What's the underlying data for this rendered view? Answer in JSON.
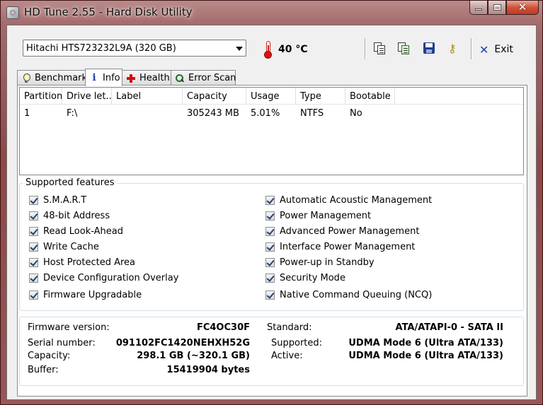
{
  "window": {
    "title": "HD Tune 2.55 - Hard Disk Utility"
  },
  "toolbar": {
    "drive": "Hitachi HTS723232L9A (320 GB)",
    "temperature": "40 °C",
    "exit_label": "Exit",
    "icons": [
      "copy-info-icon",
      "copy-icon",
      "save-icon",
      "options-icon"
    ]
  },
  "tabs": [
    {
      "label": "Benchmark",
      "icon": "lightbulb-icon"
    },
    {
      "label": "Info",
      "icon": "info-icon",
      "active": true
    },
    {
      "label": "Health",
      "icon": "health-cross-icon"
    },
    {
      "label": "Error Scan",
      "icon": "magnifier-icon"
    }
  ],
  "partitions": {
    "columns": [
      "Partition",
      "Drive let...",
      "Label",
      "Capacity",
      "Usage",
      "Type",
      "Bootable"
    ],
    "rows": [
      [
        "1",
        "F:\\",
        "",
        "305243 MB",
        "5.01%",
        "NTFS",
        "No"
      ]
    ]
  },
  "features": {
    "title": "Supported features",
    "left": [
      {
        "label": "S.M.A.R.T",
        "checked": true
      },
      {
        "label": "48-bit Address",
        "checked": true
      },
      {
        "label": "Read Look-Ahead",
        "checked": true
      },
      {
        "label": "Write Cache",
        "checked": true
      },
      {
        "label": "Host Protected Area",
        "checked": true
      },
      {
        "label": "Device Configuration Overlay",
        "checked": true
      },
      {
        "label": "Firmware Upgradable",
        "checked": true
      }
    ],
    "right": [
      {
        "label": "Automatic Acoustic Management",
        "checked": true
      },
      {
        "label": "Power Management",
        "checked": true
      },
      {
        "label": "Advanced Power Management",
        "checked": true
      },
      {
        "label": "Interface Power Management",
        "checked": true
      },
      {
        "label": "Power-up in Standby",
        "checked": true
      },
      {
        "label": "Security Mode",
        "checked": true
      },
      {
        "label": "Native Command Queuing (NCQ)",
        "checked": true
      }
    ]
  },
  "details": {
    "firmware_label": "Firmware version:",
    "firmware": "FC4OC30F",
    "serial_label": "Serial number:",
    "serial": "091102FC1420NEHXH52G",
    "capacity_label": "Capacity:",
    "capacity": "298.1 GB (~320.1 GB)",
    "buffer_label": "Buffer:",
    "buffer": "15419904 bytes",
    "standard_label": "Standard:",
    "standard": "ATA/ATAPI-0 - SATA II",
    "supported_label": "Supported:",
    "supported": "UDMA Mode 6 (Ultra ATA/133)",
    "active_label": "Active:",
    "active": "UDMA Mode 6 (Ultra ATA/133)"
  }
}
